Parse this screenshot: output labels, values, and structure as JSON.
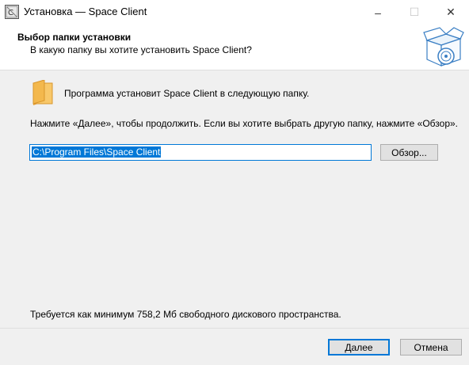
{
  "window": {
    "title": "Установка — Space Client",
    "app_icon": "setup-app-icon",
    "controls": {
      "minimize": "–",
      "maximize": "☐",
      "close": "✕"
    }
  },
  "header": {
    "title": "Выбор папки установки",
    "subtitle": "В какую папку вы хотите установить Space Client?",
    "icon": "installer-box-icon"
  },
  "body": {
    "folder_icon": "folder-icon",
    "info_text": "Программа установит Space Client в следующую папку.",
    "instruction": "Нажмите «Далее», чтобы продолжить. Если вы хотите выбрать другую папку, нажмите «Обзор».",
    "path_value": "C:\\Program Files\\Space Client",
    "browse_label": "Обзор...",
    "space_required": "Требуется как минимум 758,2 Мб свободного дискового пространства."
  },
  "footer": {
    "next_label": "Далее",
    "cancel_label": "Отмена"
  },
  "colors": {
    "accent": "#0078d7",
    "window_bg": "#f0f0f0",
    "header_bg": "#ffffff"
  }
}
